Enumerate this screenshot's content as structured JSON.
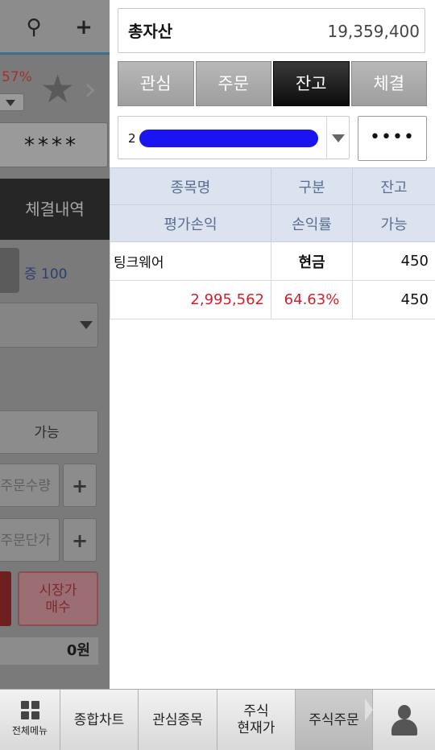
{
  "background_app": {
    "search_icon": "search-icon",
    "add_icon": "plus-icon",
    "change_pct": "57%",
    "password_mask": "****",
    "history_label": "체결내역",
    "qty_label": "증 100",
    "possible_label": "가능",
    "order_qty_placeholder": "주문수량",
    "order_price_placeholder": "주문단가",
    "plus_label": "+",
    "market_buy_label": "시장가\n매수",
    "total_label": "0원"
  },
  "summary": {
    "total_assets_label": "총자산",
    "total_assets_value": "19,359,400"
  },
  "tabs": [
    {
      "label": "관심",
      "active": false
    },
    {
      "label": "주문",
      "active": false
    },
    {
      "label": "잔고",
      "active": true
    },
    {
      "label": "체결",
      "active": false
    }
  ],
  "account": {
    "number_prefix": "2",
    "password_dots": "••••"
  },
  "table": {
    "headers_row1": [
      "종목명",
      "구분",
      "잔고"
    ],
    "headers_row2": [
      "평가손익",
      "손익률",
      "가능"
    ],
    "rows": [
      {
        "name": "팅크웨어",
        "type": "현금",
        "balance": "450",
        "eval_pl": "2,995,562",
        "pl_rate": "64.63%",
        "available": "450"
      }
    ]
  },
  "bottom_nav": {
    "menu_label": "전체메뉴",
    "items": [
      {
        "label": "종합차트"
      },
      {
        "label": "관심종목"
      },
      {
        "label": "주식\n현재가"
      },
      {
        "label": "주식주문"
      }
    ],
    "profile_icon": "user-icon"
  },
  "colors": {
    "active_tab": "#111111",
    "loss_profit_red": "#d11f2c",
    "header_bg": "#dbe3ef",
    "mask_blue": "#1a14f0"
  }
}
